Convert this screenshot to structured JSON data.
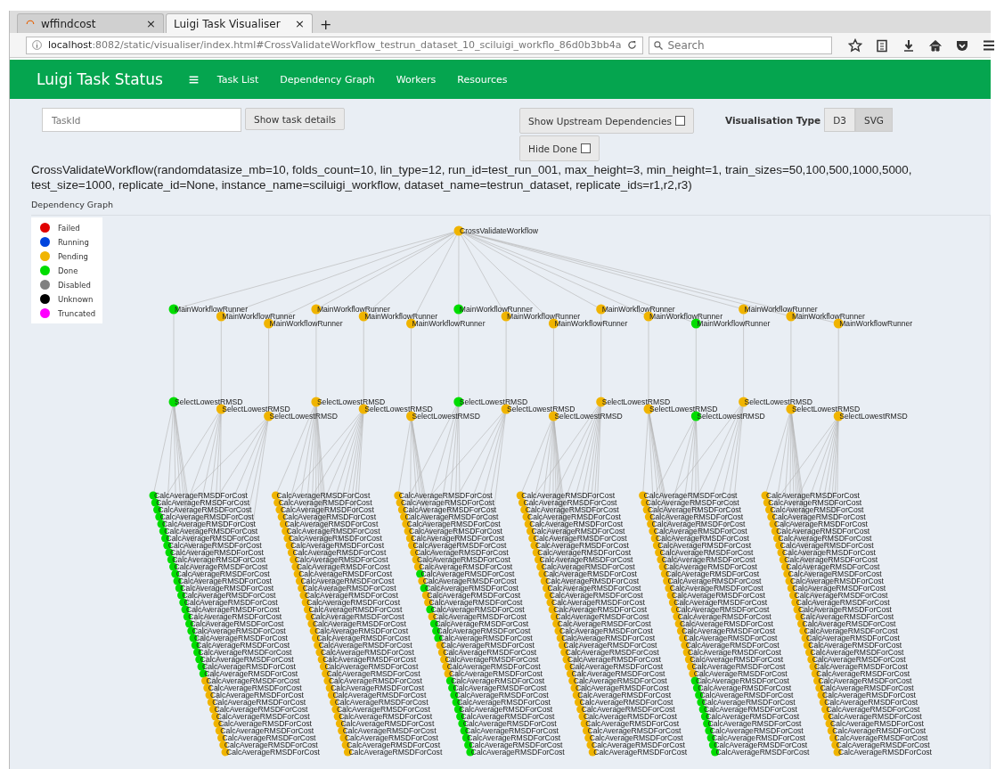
{
  "browser": {
    "tabs": [
      {
        "title": "wffindcost",
        "selected": false,
        "close": "×"
      },
      {
        "title": "Luigi Task Visualiser",
        "selected": true,
        "close": "×"
      }
    ],
    "new_tab": "+",
    "url": "**localhost**:8082/static/visualiser/index.html#CrossValidateWorkflow_testrun_dataset_10_sciluigi_workflo_86d0b3bb4a",
    "search": {
      "placeholder": "Search"
    }
  },
  "navbar": {
    "brand": "Luigi Task Status",
    "links": [
      "Task List",
      "Dependency Graph",
      "Workers",
      "Resources"
    ]
  },
  "controls": {
    "task_id": {
      "placeholder": "TaskId"
    },
    "show_details": "Show task details",
    "upstream": {
      "label": "Show Upstream Dependencies",
      "checked": false
    },
    "hide_done": {
      "label": "Hide Done",
      "checked": false
    },
    "vis_type": {
      "label": "Visualisation Type",
      "options": [
        {
          "label": "D3",
          "selected": false
        },
        {
          "label": "SVG",
          "selected": true
        }
      ]
    }
  },
  "task_title": "CrossValidateWorkflow(randomdatasize_mb=10, folds_count=10, lin_type=12, run_id=test_run_001, max_height=3, min_height=1, train_sizes=50,100,500,1000,5000, test_size=1000, replicate_id=None, instance_name=sciluigi_workflow, dataset_name=testrun_dataset, replicate_ids=r1,r2,r3)",
  "graph_heading": "Dependency Graph",
  "legend": [
    {
      "label": "Failed",
      "color": "#e00000"
    },
    {
      "label": "Running",
      "color": "#0044dd"
    },
    {
      "label": "Pending",
      "color": "#f0b400"
    },
    {
      "label": "Done",
      "color": "#00dd00"
    },
    {
      "label": "Disabled",
      "color": "#808080"
    },
    {
      "label": "Unknown",
      "color": "#000000"
    },
    {
      "label": "Truncated",
      "color": "#ff00ff"
    }
  ],
  "graph": {
    "root": {
      "label": "CrossValidateWorkflow",
      "color": "#f0b400"
    },
    "runners": [
      {
        "label": "MainWorkflowRunner",
        "color": "#00dd00",
        "select": {
          "label": "SelectLowestRMSD",
          "color": "#00dd00"
        }
      },
      {
        "label": "MainWorkflowRunner",
        "color": "#f0b400",
        "select": {
          "label": "SelectLowestRMSD",
          "color": "#f0b400"
        }
      },
      {
        "label": "MainWorkflowRunner",
        "color": "#f0b400",
        "select": {
          "label": "SelectLowestRMSD",
          "color": "#f0b400"
        }
      },
      {
        "label": "MainWorkflowRunner",
        "color": "#f0b400",
        "select": {
          "label": "SelectLowestRMSD",
          "color": "#f0b400"
        }
      },
      {
        "label": "MainWorkflowRunner",
        "color": "#f0b400",
        "select": {
          "label": "SelectLowestRMSD",
          "color": "#f0b400"
        }
      },
      {
        "label": "MainWorkflowRunner",
        "color": "#f0b400",
        "select": {
          "label": "SelectLowestRMSD",
          "color": "#f0b400"
        }
      },
      {
        "label": "MainWorkflowRunner",
        "color": "#00dd00",
        "select": {
          "label": "SelectLowestRMSD",
          "color": "#00dd00"
        }
      },
      {
        "label": "MainWorkflowRunner",
        "color": "#f0b400",
        "select": {
          "label": "SelectLowestRMSD",
          "color": "#f0b400"
        }
      },
      {
        "label": "MainWorkflowRunner",
        "color": "#f0b400",
        "select": {
          "label": "SelectLowestRMSD",
          "color": "#f0b400"
        }
      },
      {
        "label": "MainWorkflowRunner",
        "color": "#f0b400",
        "select": {
          "label": "SelectLowestRMSD",
          "color": "#f0b400"
        }
      },
      {
        "label": "MainWorkflowRunner",
        "color": "#f0b400",
        "select": {
          "label": "SelectLowestRMSD",
          "color": "#f0b400"
        }
      },
      {
        "label": "MainWorkflowRunner",
        "color": "#00dd00",
        "select": {
          "label": "SelectLowestRMSD",
          "color": "#00dd00"
        }
      },
      {
        "label": "MainWorkflowRunner",
        "color": "#f0b400",
        "select": {
          "label": "SelectLowestRMSD",
          "color": "#f0b400"
        }
      },
      {
        "label": "MainWorkflowRunner",
        "color": "#f0b400",
        "select": {
          "label": "SelectLowestRMSD",
          "color": "#f0b400"
        }
      },
      {
        "label": "MainWorkflowRunner",
        "color": "#f0b400",
        "select": {
          "label": "SelectLowestRMSD",
          "color": "#f0b400"
        }
      }
    ],
    "calc_columns": [
      {
        "nodes": [
          {
            "label": "CalcAverageRMSDForCost",
            "color": "#00dd00"
          },
          {
            "label": "CalcAverageRMSDForCost",
            "color": "#00dd00"
          },
          {
            "label": "CalcAverageRMSDForCost",
            "color": "#00dd00"
          },
          {
            "label": "CalcAverageRMSDForCost",
            "color": "#00dd00"
          },
          {
            "label": "CalcAverageRMSDForCost",
            "color": "#00dd00"
          },
          {
            "label": "CalcAverageRMSDForCost",
            "color": "#00dd00"
          },
          {
            "label": "CalcAverageRMSDForCost",
            "color": "#00dd00"
          },
          {
            "label": "CalcAverageRMSDForCost",
            "color": "#00dd00"
          },
          {
            "label": "CalcAverageRMSDForCost",
            "color": "#00dd00"
          },
          {
            "label": "CalcAverageRMSDForCost",
            "color": "#00dd00"
          },
          {
            "label": "CalcAverageRMSDForCost",
            "color": "#00dd00"
          },
          {
            "label": "CalcAverageRMSDForCost",
            "color": "#00dd00"
          },
          {
            "label": "CalcAverageRMSDForCost",
            "color": "#00dd00"
          },
          {
            "label": "CalcAverageRMSDForCost",
            "color": "#00dd00"
          },
          {
            "label": "CalcAverageRMSDForCost",
            "color": "#00dd00"
          },
          {
            "label": "CalcAverageRMSDForCost",
            "color": "#00dd00"
          },
          {
            "label": "CalcAverageRMSDForCost",
            "color": "#00dd00"
          },
          {
            "label": "CalcAverageRMSDForCost",
            "color": "#00dd00"
          },
          {
            "label": "CalcAverageRMSDForCost",
            "color": "#00dd00"
          },
          {
            "label": "CalcAverageRMSDForCost",
            "color": "#00dd00"
          },
          {
            "label": "CalcAverageRMSDForCost",
            "color": "#00dd00"
          },
          {
            "label": "CalcAverageRMSDForCost",
            "color": "#00dd00"
          },
          {
            "label": "CalcAverageRMSDForCost",
            "color": "#00dd00"
          },
          {
            "label": "CalcAverageRMSDForCost",
            "color": "#00dd00"
          },
          {
            "label": "CalcAverageRMSDForCost",
            "color": "#00dd00"
          },
          {
            "label": "CalcAverageRMSDForCost",
            "color": "#00dd00"
          },
          {
            "label": "CalcAverageRMSDForCost",
            "color": "#f0b400"
          },
          {
            "label": "CalcAverageRMSDForCost",
            "color": "#f0b400"
          },
          {
            "label": "CalcAverageRMSDForCost",
            "color": "#f0b400"
          },
          {
            "label": "CalcAverageRMSDForCost",
            "color": "#f0b400"
          },
          {
            "label": "CalcAverageRMSDForCost",
            "color": "#f0b400"
          },
          {
            "label": "CalcAverageRMSDForCost",
            "color": "#f0b400"
          },
          {
            "label": "CalcAverageRMSDForCost",
            "color": "#f0b400"
          },
          {
            "label": "CalcAverageRMSDForCost",
            "color": "#f0b400"
          },
          {
            "label": "CalcAverageRMSDForCost",
            "color": "#f0b400"
          },
          {
            "label": "CalcAverageRMSDForCost",
            "color": "#f0b400"
          },
          {
            "label": "CalcAverageRMSDForCost",
            "color": "#f0b400"
          }
        ]
      },
      {
        "nodes": [
          {
            "label": "CalcAverageRMSDForCost",
            "color": "#f0b400"
          },
          {
            "label": "CalcAverageRMSDForCost",
            "color": "#f0b400"
          },
          {
            "label": "CalcAverageRMSDForCost",
            "color": "#f0b400"
          },
          {
            "label": "CalcAverageRMSDForCost",
            "color": "#f0b400"
          },
          {
            "label": "CalcAverageRMSDForCost",
            "color": "#f0b400"
          },
          {
            "label": "CalcAverageRMSDForCost",
            "color": "#f0b400"
          },
          {
            "label": "CalcAverageRMSDForCost",
            "color": "#f0b400"
          },
          {
            "label": "CalcAverageRMSDForCost",
            "color": "#f0b400"
          },
          {
            "label": "CalcAverageRMSDForCost",
            "color": "#f0b400"
          },
          {
            "label": "CalcAverageRMSDForCost",
            "color": "#f0b400"
          },
          {
            "label": "CalcAverageRMSDForCost",
            "color": "#f0b400"
          },
          {
            "label": "CalcAverageRMSDForCost",
            "color": "#f0b400"
          },
          {
            "label": "CalcAverageRMSDForCost",
            "color": "#f0b400"
          },
          {
            "label": "CalcAverageRMSDForCost",
            "color": "#f0b400"
          },
          {
            "label": "CalcAverageRMSDForCost",
            "color": "#f0b400"
          },
          {
            "label": "CalcAverageRMSDForCost",
            "color": "#f0b400"
          },
          {
            "label": "CalcAverageRMSDForCost",
            "color": "#f0b400"
          },
          {
            "label": "CalcAverageRMSDForCost",
            "color": "#f0b400"
          },
          {
            "label": "CalcAverageRMSDForCost",
            "color": "#f0b400"
          },
          {
            "label": "CalcAverageRMSDForCost",
            "color": "#f0b400"
          },
          {
            "label": "CalcAverageRMSDForCost",
            "color": "#f0b400"
          },
          {
            "label": "CalcAverageRMSDForCost",
            "color": "#f0b400"
          },
          {
            "label": "CalcAverageRMSDForCost",
            "color": "#f0b400"
          },
          {
            "label": "CalcAverageRMSDForCost",
            "color": "#f0b400"
          },
          {
            "label": "CalcAverageRMSDForCost",
            "color": "#f0b400"
          },
          {
            "label": "CalcAverageRMSDForCost",
            "color": "#f0b400"
          },
          {
            "label": "CalcAverageRMSDForCost",
            "color": "#f0b400"
          },
          {
            "label": "CalcAverageRMSDForCost",
            "color": "#f0b400"
          },
          {
            "label": "CalcAverageRMSDForCost",
            "color": "#f0b400"
          },
          {
            "label": "CalcAverageRMSDForCost",
            "color": "#f0b400"
          },
          {
            "label": "CalcAverageRMSDForCost",
            "color": "#f0b400"
          },
          {
            "label": "CalcAverageRMSDForCost",
            "color": "#f0b400"
          },
          {
            "label": "CalcAverageRMSDForCost",
            "color": "#f0b400"
          },
          {
            "label": "CalcAverageRMSDForCost",
            "color": "#f0b400"
          },
          {
            "label": "CalcAverageRMSDForCost",
            "color": "#f0b400"
          },
          {
            "label": "CalcAverageRMSDForCost",
            "color": "#f0b400"
          },
          {
            "label": "CalcAverageRMSDForCost",
            "color": "#f0b400"
          }
        ]
      },
      {
        "nodes": [
          {
            "label": "CalcAverageRMSDForCost",
            "color": "#f0b400"
          },
          {
            "label": "CalcAverageRMSDForCost",
            "color": "#f0b400"
          },
          {
            "label": "CalcAverageRMSDForCost",
            "color": "#f0b400"
          },
          {
            "label": "CalcAverageRMSDForCost",
            "color": "#f0b400"
          },
          {
            "label": "CalcAverageRMSDForCost",
            "color": "#f0b400"
          },
          {
            "label": "CalcAverageRMSDForCost",
            "color": "#f0b400"
          },
          {
            "label": "CalcAverageRMSDForCost",
            "color": "#f0b400"
          },
          {
            "label": "CalcAverageRMSDForCost",
            "color": "#f0b400"
          },
          {
            "label": "CalcAverageRMSDForCost",
            "color": "#f0b400"
          },
          {
            "label": "CalcAverageRMSDForCost",
            "color": "#f0b400"
          },
          {
            "label": "CalcAverageRMSDForCost",
            "color": "#f0b400"
          },
          {
            "label": "CalcAverageRMSDForCost",
            "color": "#00dd00"
          },
          {
            "label": "CalcAverageRMSDForCost",
            "color": "#f0b400"
          },
          {
            "label": "CalcAverageRMSDForCost",
            "color": "#00dd00"
          },
          {
            "label": "CalcAverageRMSDForCost",
            "color": "#f0b400"
          },
          {
            "label": "CalcAverageRMSDForCost",
            "color": "#f0b400"
          },
          {
            "label": "CalcAverageRMSDForCost",
            "color": "#00dd00"
          },
          {
            "label": "CalcAverageRMSDForCost",
            "color": "#f0b400"
          },
          {
            "label": "CalcAverageRMSDForCost",
            "color": "#00dd00"
          },
          {
            "label": "CalcAverageRMSDForCost",
            "color": "#00dd00"
          },
          {
            "label": "CalcAverageRMSDForCost",
            "color": "#00dd00"
          },
          {
            "label": "CalcAverageRMSDForCost",
            "color": "#f0b400"
          },
          {
            "label": "CalcAverageRMSDForCost",
            "color": "#f0b400"
          },
          {
            "label": "CalcAverageRMSDForCost",
            "color": "#f0b400"
          },
          {
            "label": "CalcAverageRMSDForCost",
            "color": "#f0b400"
          },
          {
            "label": "CalcAverageRMSDForCost",
            "color": "#f0b400"
          },
          {
            "label": "CalcAverageRMSDForCost",
            "color": "#00dd00"
          },
          {
            "label": "CalcAverageRMSDForCost",
            "color": "#00dd00"
          },
          {
            "label": "CalcAverageRMSDForCost",
            "color": "#00dd00"
          },
          {
            "label": "CalcAverageRMSDForCost",
            "color": "#00dd00"
          },
          {
            "label": "CalcAverageRMSDForCost",
            "color": "#00dd00"
          },
          {
            "label": "CalcAverageRMSDForCost",
            "color": "#00dd00"
          },
          {
            "label": "CalcAverageRMSDForCost",
            "color": "#00dd00"
          },
          {
            "label": "CalcAverageRMSDForCost",
            "color": "#00dd00"
          },
          {
            "label": "CalcAverageRMSDForCost",
            "color": "#00dd00"
          },
          {
            "label": "CalcAverageRMSDForCost",
            "color": "#00dd00"
          },
          {
            "label": "CalcAverageRMSDForCost",
            "color": "#00dd00"
          }
        ]
      },
      {
        "nodes": [
          {
            "label": "CalcAverageRMSDForCost",
            "color": "#f0b400"
          },
          {
            "label": "CalcAverageRMSDForCost",
            "color": "#f0b400"
          },
          {
            "label": "CalcAverageRMSDForCost",
            "color": "#f0b400"
          },
          {
            "label": "CalcAverageRMSDForCost",
            "color": "#f0b400"
          },
          {
            "label": "CalcAverageRMSDForCost",
            "color": "#f0b400"
          },
          {
            "label": "CalcAverageRMSDForCost",
            "color": "#f0b400"
          },
          {
            "label": "CalcAverageRMSDForCost",
            "color": "#f0b400"
          },
          {
            "label": "CalcAverageRMSDForCost",
            "color": "#f0b400"
          },
          {
            "label": "CalcAverageRMSDForCost",
            "color": "#f0b400"
          },
          {
            "label": "CalcAverageRMSDForCost",
            "color": "#f0b400"
          },
          {
            "label": "CalcAverageRMSDForCost",
            "color": "#f0b400"
          },
          {
            "label": "CalcAverageRMSDForCost",
            "color": "#f0b400"
          },
          {
            "label": "CalcAverageRMSDForCost",
            "color": "#f0b400"
          },
          {
            "label": "CalcAverageRMSDForCost",
            "color": "#f0b400"
          },
          {
            "label": "CalcAverageRMSDForCost",
            "color": "#f0b400"
          },
          {
            "label": "CalcAverageRMSDForCost",
            "color": "#f0b400"
          },
          {
            "label": "CalcAverageRMSDForCost",
            "color": "#f0b400"
          },
          {
            "label": "CalcAverageRMSDForCost",
            "color": "#f0b400"
          },
          {
            "label": "CalcAverageRMSDForCost",
            "color": "#f0b400"
          },
          {
            "label": "CalcAverageRMSDForCost",
            "color": "#f0b400"
          },
          {
            "label": "CalcAverageRMSDForCost",
            "color": "#f0b400"
          },
          {
            "label": "CalcAverageRMSDForCost",
            "color": "#f0b400"
          },
          {
            "label": "CalcAverageRMSDForCost",
            "color": "#f0b400"
          },
          {
            "label": "CalcAverageRMSDForCost",
            "color": "#f0b400"
          },
          {
            "label": "CalcAverageRMSDForCost",
            "color": "#f0b400"
          },
          {
            "label": "CalcAverageRMSDForCost",
            "color": "#f0b400"
          },
          {
            "label": "CalcAverageRMSDForCost",
            "color": "#f0b400"
          },
          {
            "label": "CalcAverageRMSDForCost",
            "color": "#f0b400"
          },
          {
            "label": "CalcAverageRMSDForCost",
            "color": "#f0b400"
          },
          {
            "label": "CalcAverageRMSDForCost",
            "color": "#f0b400"
          },
          {
            "label": "CalcAverageRMSDForCost",
            "color": "#f0b400"
          },
          {
            "label": "CalcAverageRMSDForCost",
            "color": "#f0b400"
          },
          {
            "label": "CalcAverageRMSDForCost",
            "color": "#f0b400"
          },
          {
            "label": "CalcAverageRMSDForCost",
            "color": "#f0b400"
          },
          {
            "label": "CalcAverageRMSDForCost",
            "color": "#f0b400"
          },
          {
            "label": "CalcAverageRMSDForCost",
            "color": "#f0b400"
          },
          {
            "label": "CalcAverageRMSDForCost",
            "color": "#f0b400"
          }
        ]
      },
      {
        "nodes": [
          {
            "label": "CalcAverageRMSDForCost",
            "color": "#f0b400"
          },
          {
            "label": "CalcAverageRMSDForCost",
            "color": "#f0b400"
          },
          {
            "label": "CalcAverageRMSDForCost",
            "color": "#f0b400"
          },
          {
            "label": "CalcAverageRMSDForCost",
            "color": "#f0b400"
          },
          {
            "label": "CalcAverageRMSDForCost",
            "color": "#f0b400"
          },
          {
            "label": "CalcAverageRMSDForCost",
            "color": "#f0b400"
          },
          {
            "label": "CalcAverageRMSDForCost",
            "color": "#f0b400"
          },
          {
            "label": "CalcAverageRMSDForCost",
            "color": "#f0b400"
          },
          {
            "label": "CalcAverageRMSDForCost",
            "color": "#f0b400"
          },
          {
            "label": "CalcAverageRMSDForCost",
            "color": "#f0b400"
          },
          {
            "label": "CalcAverageRMSDForCost",
            "color": "#f0b400"
          },
          {
            "label": "CalcAverageRMSDForCost",
            "color": "#f0b400"
          },
          {
            "label": "CalcAverageRMSDForCost",
            "color": "#f0b400"
          },
          {
            "label": "CalcAverageRMSDForCost",
            "color": "#f0b400"
          },
          {
            "label": "CalcAverageRMSDForCost",
            "color": "#f0b400"
          },
          {
            "label": "CalcAverageRMSDForCost",
            "color": "#f0b400"
          },
          {
            "label": "CalcAverageRMSDForCost",
            "color": "#f0b400"
          },
          {
            "label": "CalcAverageRMSDForCost",
            "color": "#f0b400"
          },
          {
            "label": "CalcAverageRMSDForCost",
            "color": "#f0b400"
          },
          {
            "label": "CalcAverageRMSDForCost",
            "color": "#f0b400"
          },
          {
            "label": "CalcAverageRMSDForCost",
            "color": "#f0b400"
          },
          {
            "label": "CalcAverageRMSDForCost",
            "color": "#f0b400"
          },
          {
            "label": "CalcAverageRMSDForCost",
            "color": "#f0b400"
          },
          {
            "label": "CalcAverageRMSDForCost",
            "color": "#f0b400"
          },
          {
            "label": "CalcAverageRMSDForCost",
            "color": "#f0b400"
          },
          {
            "label": "CalcAverageRMSDForCost",
            "color": "#f0b400"
          },
          {
            "label": "CalcAverageRMSDForCost",
            "color": "#00dd00"
          },
          {
            "label": "CalcAverageRMSDForCost",
            "color": "#00dd00"
          },
          {
            "label": "CalcAverageRMSDForCost",
            "color": "#00dd00"
          },
          {
            "label": "CalcAverageRMSDForCost",
            "color": "#00dd00"
          },
          {
            "label": "CalcAverageRMSDForCost",
            "color": "#00dd00"
          },
          {
            "label": "CalcAverageRMSDForCost",
            "color": "#00dd00"
          },
          {
            "label": "CalcAverageRMSDForCost",
            "color": "#00dd00"
          },
          {
            "label": "CalcAverageRMSDForCost",
            "color": "#00dd00"
          },
          {
            "label": "CalcAverageRMSDForCost",
            "color": "#00dd00"
          },
          {
            "label": "CalcAverageRMSDForCost",
            "color": "#00dd00"
          },
          {
            "label": "CalcAverageRMSDForCost",
            "color": "#00dd00"
          }
        ]
      },
      {
        "nodes": [
          {
            "label": "CalcAverageRMSDForCost",
            "color": "#f0b400"
          },
          {
            "label": "CalcAverageRMSDForCost",
            "color": "#f0b400"
          },
          {
            "label": "CalcAverageRMSDForCost",
            "color": "#f0b400"
          },
          {
            "label": "CalcAverageRMSDForCost",
            "color": "#f0b400"
          },
          {
            "label": "CalcAverageRMSDForCost",
            "color": "#f0b400"
          },
          {
            "label": "CalcAverageRMSDForCost",
            "color": "#f0b400"
          },
          {
            "label": "CalcAverageRMSDForCost",
            "color": "#f0b400"
          },
          {
            "label": "CalcAverageRMSDForCost",
            "color": "#f0b400"
          },
          {
            "label": "CalcAverageRMSDForCost",
            "color": "#f0b400"
          },
          {
            "label": "CalcAverageRMSDForCost",
            "color": "#f0b400"
          },
          {
            "label": "CalcAverageRMSDForCost",
            "color": "#f0b400"
          },
          {
            "label": "CalcAverageRMSDForCost",
            "color": "#f0b400"
          },
          {
            "label": "CalcAverageRMSDForCost",
            "color": "#f0b400"
          },
          {
            "label": "CalcAverageRMSDForCost",
            "color": "#f0b400"
          },
          {
            "label": "CalcAverageRMSDForCost",
            "color": "#f0b400"
          },
          {
            "label": "CalcAverageRMSDForCost",
            "color": "#f0b400"
          },
          {
            "label": "CalcAverageRMSDForCost",
            "color": "#f0b400"
          },
          {
            "label": "CalcAverageRMSDForCost",
            "color": "#f0b400"
          },
          {
            "label": "CalcAverageRMSDForCost",
            "color": "#f0b400"
          },
          {
            "label": "CalcAverageRMSDForCost",
            "color": "#f0b400"
          },
          {
            "label": "CalcAverageRMSDForCost",
            "color": "#f0b400"
          },
          {
            "label": "CalcAverageRMSDForCost",
            "color": "#f0b400"
          },
          {
            "label": "CalcAverageRMSDForCost",
            "color": "#f0b400"
          },
          {
            "label": "CalcAverageRMSDForCost",
            "color": "#f0b400"
          },
          {
            "label": "CalcAverageRMSDForCost",
            "color": "#f0b400"
          },
          {
            "label": "CalcAverageRMSDForCost",
            "color": "#f0b400"
          },
          {
            "label": "CalcAverageRMSDForCost",
            "color": "#f0b400"
          },
          {
            "label": "CalcAverageRMSDForCost",
            "color": "#f0b400"
          },
          {
            "label": "CalcAverageRMSDForCost",
            "color": "#f0b400"
          },
          {
            "label": "CalcAverageRMSDForCost",
            "color": "#f0b400"
          },
          {
            "label": "CalcAverageRMSDForCost",
            "color": "#f0b400"
          },
          {
            "label": "CalcAverageRMSDForCost",
            "color": "#f0b400"
          },
          {
            "label": "CalcAverageRMSDForCost",
            "color": "#f0b400"
          },
          {
            "label": "CalcAverageRMSDForCost",
            "color": "#f0b400"
          },
          {
            "label": "CalcAverageRMSDForCost",
            "color": "#f0b400"
          },
          {
            "label": "CalcAverageRMSDForCost",
            "color": "#f0b400"
          },
          {
            "label": "CalcAverageRMSDForCost",
            "color": "#f0b400"
          }
        ]
      }
    ]
  }
}
